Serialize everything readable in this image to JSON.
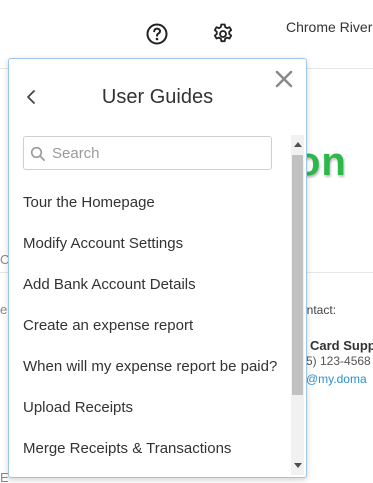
{
  "header": {
    "user_name": "Chrome River",
    "help_icon": "question-circle-icon",
    "settings_icon": "gear-icon"
  },
  "background": {
    "logo_fragment": "on",
    "left_fragment_1": "C",
    "left_fragment_2": "e",
    "left_fragment_3": "E",
    "contact_label": "ontact:",
    "support_title": "Card Supp",
    "support_phone": "5) 123-4568",
    "support_email": "@my.doma"
  },
  "panel": {
    "title": "User Guides",
    "back_icon": "chevron-left-icon",
    "close_icon": "close-icon",
    "search": {
      "placeholder": "Search",
      "value": "",
      "icon": "search-icon"
    },
    "guides": [
      {
        "label": "Tour the Homepage"
      },
      {
        "label": "Modify Account Settings"
      },
      {
        "label": "Add Bank Account Details"
      },
      {
        "label": "Create an expense report"
      },
      {
        "label": "When will my expense report be paid?"
      },
      {
        "label": "Upload Receipts"
      },
      {
        "label": "Merge Receipts & Transactions"
      }
    ]
  },
  "colors": {
    "accent_green": "#2db84a",
    "panel_border": "#9fc6e6",
    "link_blue": "#2a8fd0"
  }
}
